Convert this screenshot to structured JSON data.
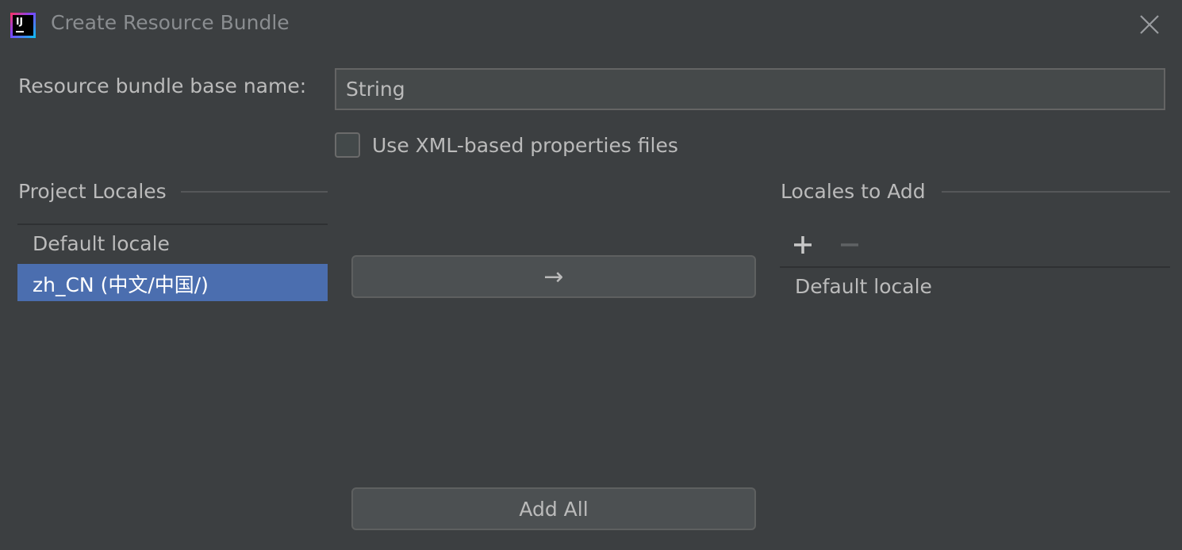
{
  "window": {
    "title": "Create Resource Bundle",
    "app_icon_text": "IJ",
    "close_icon": "close-icon"
  },
  "form": {
    "base_name_label": "Resource bundle base name:",
    "base_name_value": "String",
    "xml_checkbox_label": "Use XML-based properties files",
    "xml_checkbox_checked": false
  },
  "project_locales": {
    "title": "Project Locales",
    "items": [
      {
        "label": "Default locale",
        "selected": false
      },
      {
        "label": "zh_CN (中文/中国/)",
        "selected": true
      }
    ]
  },
  "actions": {
    "move_arrow": "→",
    "add_all_label": "Add All"
  },
  "locales_to_add": {
    "title": "Locales to Add",
    "add_icon": "plus-icon",
    "remove_icon": "minus-icon",
    "items": [
      {
        "label": "Default locale"
      }
    ]
  },
  "colors": {
    "background": "#3c3f41",
    "selection": "#4b6eaf",
    "text": "#bbbbbb"
  }
}
